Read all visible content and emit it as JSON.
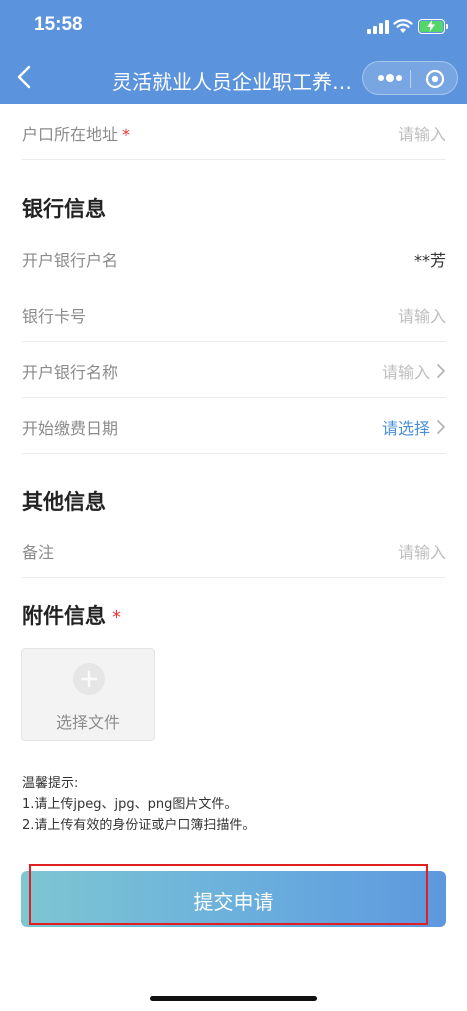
{
  "status_bar": {
    "time": "15:58"
  },
  "nav": {
    "title": "灵活就业人员企业职工养老保险参保登记"
  },
  "fields": {
    "hukou_address": {
      "label": "户口所在地址",
      "required_mark": "*",
      "placeholder": "请输入"
    }
  },
  "bank_section": {
    "title": "银行信息",
    "account_name": {
      "label": "开户银行户名",
      "value": "**芳"
    },
    "card_number": {
      "label": "银行卡号",
      "placeholder": "请输入"
    },
    "bank_name": {
      "label": "开户银行名称",
      "placeholder": "请输入"
    },
    "start_date": {
      "label": "开始缴费日期",
      "placeholder": "请选择"
    }
  },
  "other_section": {
    "title": "其他信息",
    "remark": {
      "label": "备注",
      "placeholder": "请输入"
    }
  },
  "attachment_section": {
    "title": "附件信息",
    "required_mark": "*",
    "upload_label": "选择文件"
  },
  "tips": {
    "title": "温馨提示:",
    "line1": "1.请上传jpeg、jpg、png图片文件。",
    "line2": "2.请上传有效的身份证或户口簿扫描件。"
  },
  "submit": {
    "label": "提交申请"
  },
  "colors": {
    "header": "#5b93dc",
    "accent_blue": "#4a90d9",
    "required_red": "#e33333",
    "highlight_red": "#e02020"
  },
  "icons": [
    "back-chevron-icon",
    "more-dots-icon",
    "close-circle-icon",
    "chevron-right-icon",
    "plus-circle-icon",
    "signal-icon",
    "wifi-icon",
    "battery-charging-icon"
  ]
}
